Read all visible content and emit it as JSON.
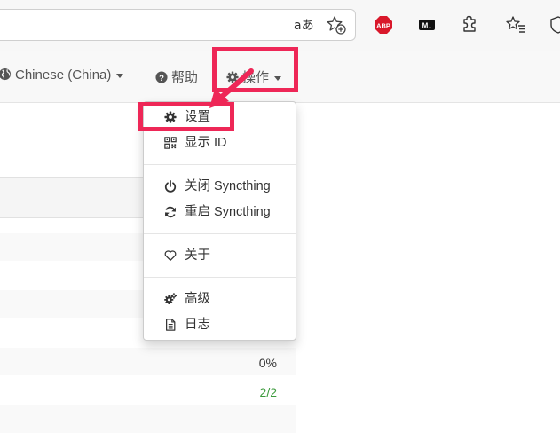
{
  "browser": {
    "read_aloud_label": "aあ",
    "icons": [
      "read-aloud-icon",
      "add-favorite-icon",
      "adblock-plus-icon",
      "markdown-icon",
      "extensions-icon",
      "favorites-icon",
      "browser-essentials-icon"
    ],
    "abp_label": "ABP",
    "md_label": "M↓"
  },
  "navbar": {
    "language": "Chinese (China)",
    "help": "帮助",
    "actions": "操作"
  },
  "dropdown": {
    "settings": "设置",
    "show_id": "显示 ID",
    "shutdown": "关闭 Syncthing",
    "restart": "重启 Syncthing",
    "about": "关于",
    "advanced": "高级",
    "logs": "日志"
  },
  "background": {
    "value_1": "0%",
    "value_2": "2/2"
  },
  "colors": {
    "highlight": "#ee2757",
    "green_value": "#3c9a3c",
    "abp_red": "#d9182b"
  }
}
